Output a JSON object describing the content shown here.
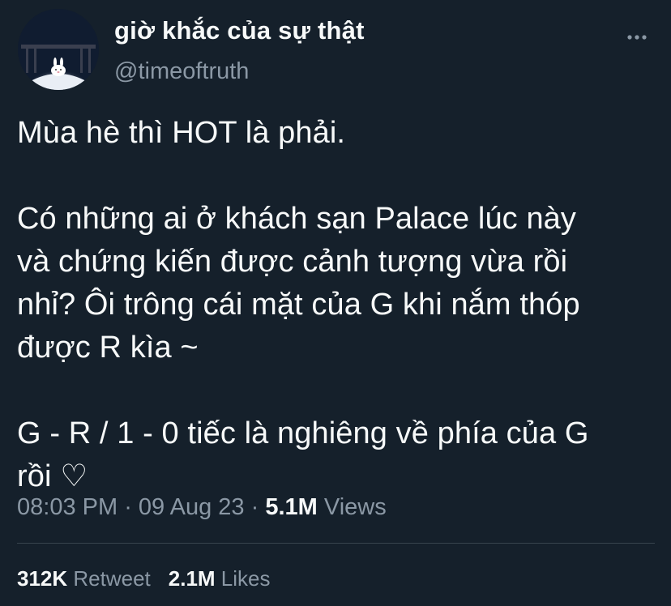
{
  "author": {
    "display_name": "giờ khắc của sự thật",
    "handle": "@timeoftruth",
    "avatar_icon": "bunny-in-bed-avatar"
  },
  "more_icon": "more-dots-icon",
  "tweet": {
    "text": "Mùa hè thì HOT là phải.\n\nCó những ai ở khách sạn Palace lúc này\nvà chứng kiến được cảnh tượng vừa rồi\nnhỉ? Ôi trông cái mặt của G khi nắm thóp\nđược R kìa ~\n\nG - R / 1 - 0 tiếc là nghiêng về phía của G\nrồi ♡"
  },
  "meta": {
    "time": "08:03 PM",
    "separator1": " · ",
    "date": "09 Aug 23",
    "separator2": " · ",
    "views_count": "5.1M",
    "views_label": " Views"
  },
  "stats": {
    "retweets_count": "312K",
    "retweets_label": " Retweet",
    "likes_count": "2.1M",
    "likes_label": " Likes"
  },
  "colors": {
    "background": "#15202b",
    "text_primary": "#f7f9f9",
    "text_secondary": "#8b98a5",
    "divider": "#38444d"
  }
}
